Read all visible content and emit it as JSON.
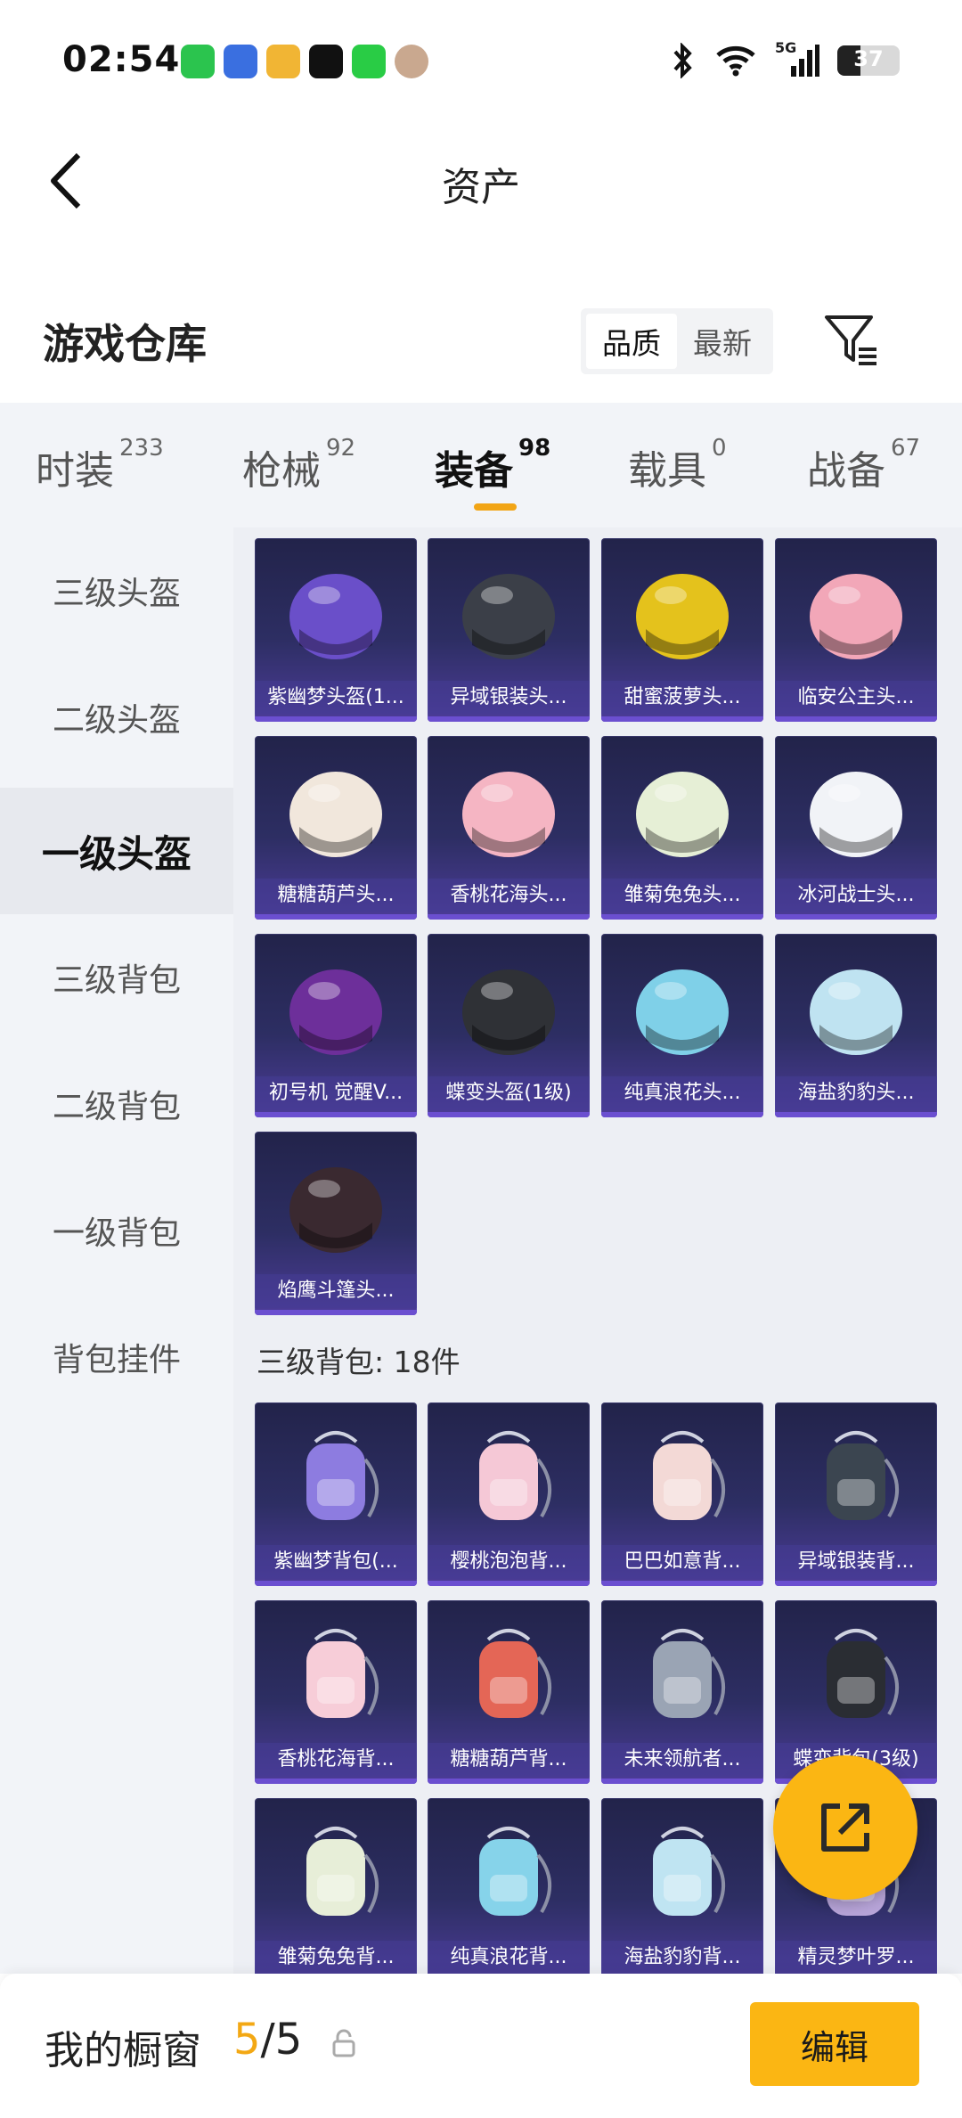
{
  "status_bar": {
    "time": "02:54",
    "battery_level": 37,
    "battery_text": "37",
    "network": "5G",
    "app_icons": [
      "wechat-icon",
      "game-app-icon",
      "music-app-icon",
      "tiktok-icon",
      "green-app-icon",
      "avatar-icon"
    ]
  },
  "header": {
    "title": "资产"
  },
  "section": {
    "title": "游戏仓库",
    "sort_options": [
      "品质",
      "最新"
    ],
    "active_sort": "品质"
  },
  "tabs": [
    {
      "label": "时装",
      "count": "233"
    },
    {
      "label": "枪械",
      "count": "92"
    },
    {
      "label": "装备",
      "count": "98"
    },
    {
      "label": "载具",
      "count": "0"
    },
    {
      "label": "战备",
      "count": "67"
    }
  ],
  "active_tab": "装备",
  "sidebar": [
    {
      "label": "三级头盔"
    },
    {
      "label": "二级头盔"
    },
    {
      "label": "一级头盔"
    },
    {
      "label": "三级背包"
    },
    {
      "label": "二级背包"
    },
    {
      "label": "一级背包"
    },
    {
      "label": "背包挂件"
    }
  ],
  "active_sidebar": "一级头盔",
  "helmets": [
    {
      "name": "紫幽梦头盔(1...",
      "color": "#6a4fc9"
    },
    {
      "name": "异域银装头...",
      "color": "#3b3f48"
    },
    {
      "name": "甜蜜菠萝头...",
      "color": "#e4c21c"
    },
    {
      "name": "临安公主头...",
      "color": "#f2a7b8"
    },
    {
      "name": "糖糖葫芦头...",
      "color": "#f1e7dc"
    },
    {
      "name": "香桃花海头...",
      "color": "#f5b5c3"
    },
    {
      "name": "雏菊兔兔头...",
      "color": "#e6efd6"
    },
    {
      "name": "冰河战士头...",
      "color": "#f1f3f7"
    },
    {
      "name": "初号机 觉醒V...",
      "color": "#6d2f9a"
    },
    {
      "name": "蝶变头盔(1级)",
      "color": "#2f3136"
    },
    {
      "name": "纯真浪花头...",
      "color": "#7fd0e8"
    },
    {
      "name": "海盐豹豹头...",
      "color": "#bfe3f1"
    },
    {
      "name": "焰鹰斗篷头...",
      "color": "#3a2930"
    }
  ],
  "backpack_group": {
    "label": "三级背包: 18件"
  },
  "backpacks": [
    {
      "name": "紫幽梦背包(...",
      "color": "#8d7ce0"
    },
    {
      "name": "樱桃泡泡背...",
      "color": "#f5c8d6"
    },
    {
      "name": "巴巴如意背...",
      "color": "#f3d9d6"
    },
    {
      "name": "异域银装背...",
      "color": "#3b4550"
    },
    {
      "name": "香桃花海背...",
      "color": "#f7cdd8"
    },
    {
      "name": "糖糖葫芦背...",
      "color": "#e46656"
    },
    {
      "name": "未来领航者...",
      "color": "#9aa4b4"
    },
    {
      "name": "蝶变背包(3级)",
      "color": "#2a2d33"
    },
    {
      "name": "雏菊兔兔背...",
      "color": "#e7eed8"
    },
    {
      "name": "纯真浪花背...",
      "color": "#86d3ea"
    },
    {
      "name": "海盐豹豹背...",
      "color": "#bfe4f2"
    },
    {
      "name": "精灵梦叶罗...",
      "color": "#b7a4d8"
    }
  ],
  "bottom_bar": {
    "label": "我的橱窗",
    "count_current": "5",
    "count_total": "/5",
    "edit_label": "编辑"
  },
  "colors": {
    "accent": "#fbb613",
    "card_bg": "#2d2e63",
    "sidebar_bg": "#f2f4f8"
  }
}
